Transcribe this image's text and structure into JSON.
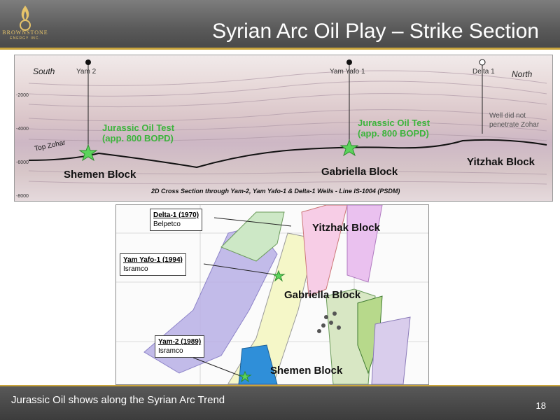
{
  "slide": {
    "title": "Syrian Arc Oil Play – Strike Section",
    "footer_text": "Jurassic Oil shows along the Syrian Arc Trend",
    "page_number": "18"
  },
  "logo": {
    "name": "BROWNSTONE",
    "sub": "ENERGY INC."
  },
  "colors": {
    "accent": "#c9a43b",
    "oil_test_green": "#3cb43c",
    "header_gray": "#5a5a5a"
  },
  "seismic": {
    "south_label": "South",
    "north_label": "North",
    "depths": [
      "-2000",
      "-4000",
      "-6000",
      "-8000"
    ],
    "wells": {
      "yam2": "Yam 2",
      "yam_yafo1": "Yam Yafo 1",
      "delta1": "Delta 1"
    },
    "oil_test_1": [
      "Jurassic Oil Test",
      "(app. 800 BOPD)"
    ],
    "oil_test_2": [
      "Jurassic Oil Test",
      "(app. 800 BOPD)"
    ],
    "top_zohar": "Top Zohar",
    "not_penetrate": "Well did not penetrate Zohar",
    "blocks": {
      "shemen": "Shemen Block",
      "gabriella": "Gabriella Block",
      "yitzhak": "Yitzhak Block"
    },
    "caption": "2D Cross Section through Yam-2, Yam Yafo-1 & Delta-1 Wells - Line IS-1004 (PSDM)"
  },
  "map": {
    "callouts": [
      {
        "well": "Delta-1 (1970)",
        "operator": "Belpetco"
      },
      {
        "well": "Yam Yafo-1 (1994)",
        "operator": "Isramco"
      },
      {
        "well": "Yam-2 (1989)",
        "operator": "Isramco"
      }
    ],
    "blocks": {
      "yitzhak": "Yitzhak Block",
      "gabriella": "Gabriella Block",
      "shemen": "Shemen Block"
    }
  }
}
